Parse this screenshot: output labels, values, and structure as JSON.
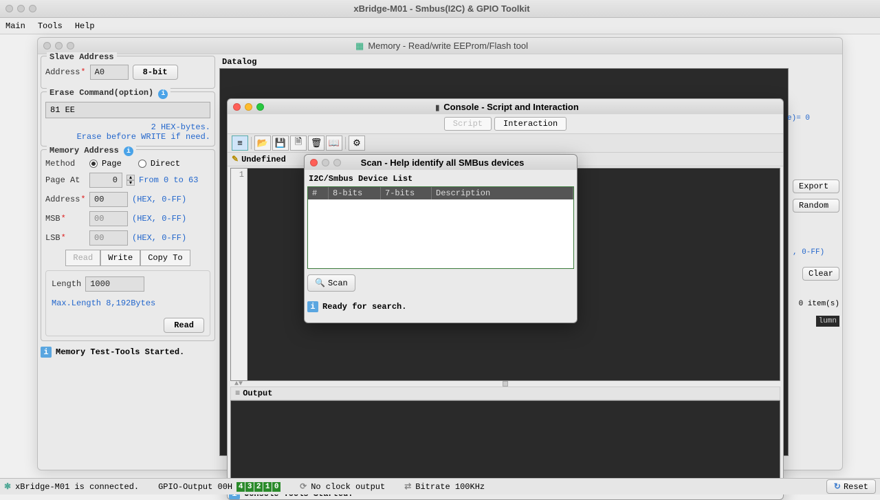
{
  "app_title": "xBridge-M01 - Smbus(I2C) & GPIO Toolkit",
  "menubar": {
    "main": "Main",
    "tools": "Tools",
    "help": "Help"
  },
  "memory_window": {
    "title": "Memory - Read/write EEProm/Flash tool",
    "slave": {
      "title": "Slave Address",
      "address_label": "Address",
      "address_value": "A0",
      "width_btn": "8-bit"
    },
    "erase": {
      "title": "Erase Command(option)",
      "value": "81 EE",
      "hex_hint": "2 HEX-bytes.",
      "warn": "Erase before WRITE if need."
    },
    "memaddr": {
      "title": "Memory Address",
      "method_label": "Method",
      "page_label": "Page",
      "direct_label": "Direct",
      "page_at_label": "Page At",
      "page_at_value": "0",
      "page_at_hint": "From 0 to 63",
      "address_label": "Address",
      "address_value": "00",
      "address_hint": "(HEX, 0-FF)",
      "msb_label": "MSB",
      "msb_value": "00",
      "msb_hint": "(HEX, 0-FF)",
      "lsb_label": "LSB",
      "lsb_value": "00",
      "lsb_hint": "(HEX, 0-FF)",
      "read_btn": "Read",
      "write_btn": "Write",
      "copy_btn": "Copy To",
      "length_label": "Length",
      "length_value": "1000",
      "length_hint": "Max.Length 8,192Bytes",
      "read_btn2": "Read"
    },
    "status": "Memory Test-Tools Started.",
    "datalog_label": "Datalog",
    "export_btn": "Export",
    "random_btn": "Random",
    "side_hint": ", 0-FF)",
    "side_hint2": "e)= 0",
    "clear_btn": "Clear",
    "items_label": "0 item(s)",
    "lumn": "lumn"
  },
  "console": {
    "title": "Console - Script and Interaction",
    "tab_script": "Script",
    "tab_interaction": "Interaction",
    "undefined": "Undefined",
    "line1": "1",
    "output_label": "Output",
    "status": "Console-Tools Started."
  },
  "scan": {
    "title": "Scan - Help identify all SMBus devices",
    "list_title": "I2C/Smbus Device List",
    "cols": {
      "c1": "#",
      "c2": "8-bits",
      "c3": "7-bits",
      "c4": "Description"
    },
    "scan_btn": "Scan",
    "status": "Ready for search."
  },
  "footer": {
    "connected": "xBridge-M01 is connected.",
    "gpio_label": "GPIO-Output 00H",
    "bits": [
      "4",
      "3",
      "2",
      "1",
      "0"
    ],
    "clock": "No clock output",
    "bitrate": "Bitrate 100KHz",
    "reset": "Reset"
  }
}
